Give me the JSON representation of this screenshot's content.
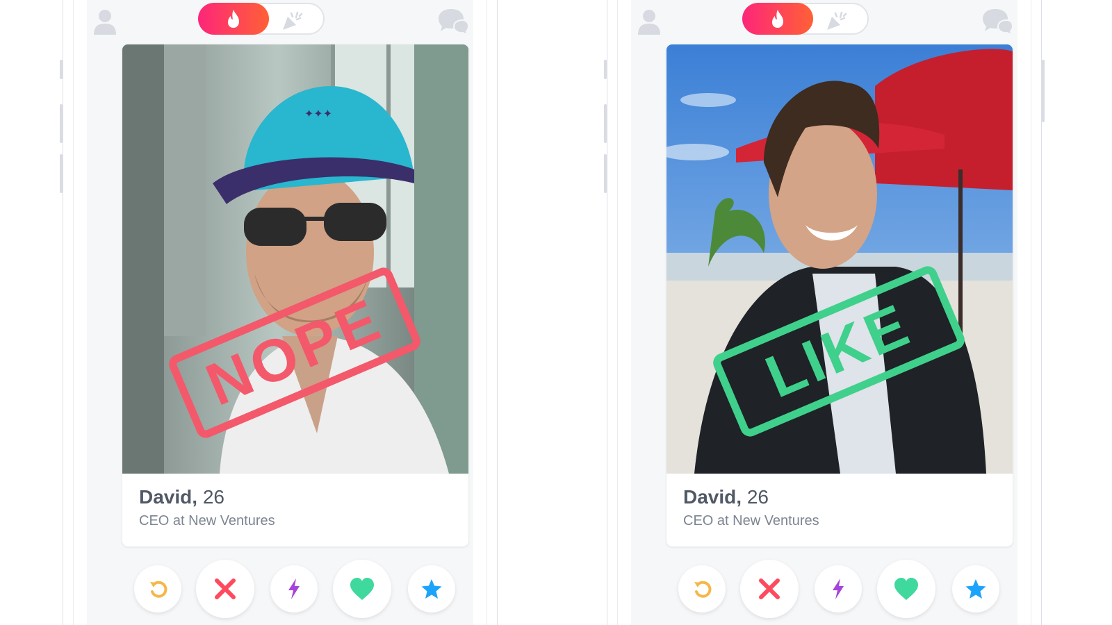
{
  "colors": {
    "brand_gradient_start": "#fd267a",
    "brand_gradient_end": "#ff6036",
    "nope": "#f3596a",
    "like": "#3fd08c",
    "rewind": "#f5b748",
    "boost": "#a743d9",
    "super_like": "#1ca4fc"
  },
  "topbar": {
    "left_icon": "profile-icon",
    "toggle_active_icon": "flame-icon",
    "toggle_inactive_icon": "party-icon",
    "right_icon": "chat-icon"
  },
  "screens": [
    {
      "stamp": "NOPE",
      "profile": {
        "name": "David,",
        "age": "26",
        "job": "CEO at New Ventures"
      }
    },
    {
      "stamp": "LIKE",
      "profile": {
        "name": "David,",
        "age": "26",
        "job": "CEO at New Ventures"
      }
    }
  ],
  "action_icons": [
    "rewind-icon",
    "nope-icon",
    "boost-icon",
    "like-icon",
    "super-like-icon"
  ]
}
